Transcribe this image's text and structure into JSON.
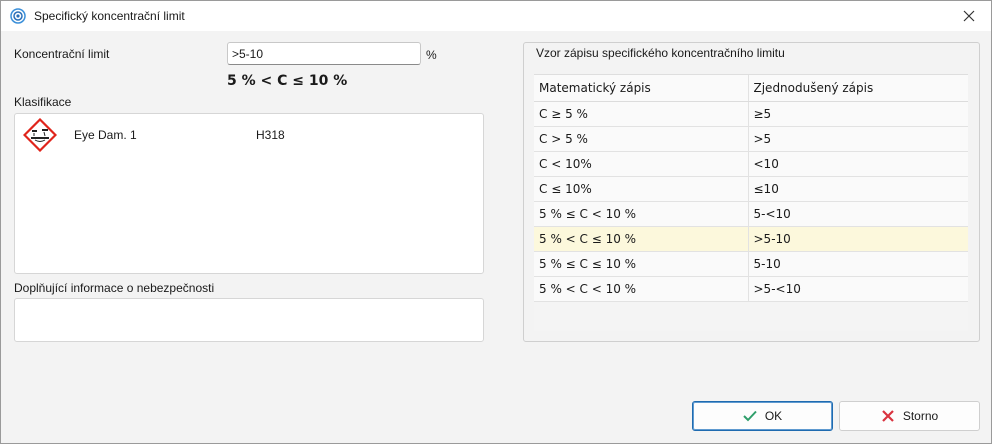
{
  "window": {
    "title": "Specifický koncentrační limit"
  },
  "concentration": {
    "label": "Koncentrační limit",
    "value": ">5-10",
    "unit": "%",
    "formula": "5 % < C ≤ 10 %"
  },
  "classification": {
    "label": "Klasifikace",
    "items": [
      {
        "icon": "corrosion-pictogram-icon",
        "name": "Eye Dam. 1",
        "code": "H318"
      }
    ]
  },
  "additional": {
    "label": "Doplňující informace o nebezpečnosti",
    "value": ""
  },
  "pattern": {
    "title": "Vzor zápisu specifického koncentračního limitu",
    "columns": [
      "Matematický zápis",
      "Zjednodušený zápis"
    ],
    "rows": [
      [
        "C ≥ 5 %",
        "≥5"
      ],
      [
        "C > 5 %",
        ">5"
      ],
      [
        "C < 10%",
        "<10"
      ],
      [
        "C ≤ 10%",
        "≤10"
      ],
      [
        "5 % ≤ C < 10 %",
        "5-<10"
      ],
      [
        "5 % < C ≤ 10 %",
        ">5-10"
      ],
      [
        "5 % ≤ C ≤ 10 %",
        "5-10"
      ],
      [
        "5 % < C < 10 %",
        ">5-<10"
      ]
    ],
    "selected_index": 5
  },
  "buttons": {
    "ok": "OK",
    "cancel": "Storno"
  },
  "colors": {
    "ok_check": "#2e9e6a",
    "cancel_x": "#d9333f",
    "selected_row": "#fcf8dc",
    "accent": "#1f6bb0"
  }
}
